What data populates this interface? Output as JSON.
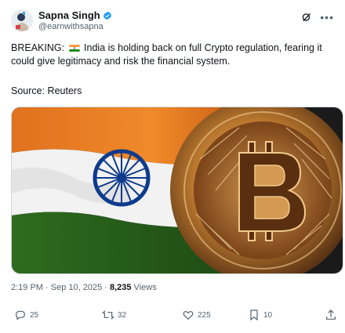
{
  "author": {
    "display_name": "Sapna Singh",
    "handle": "@earnwithsapna",
    "verified_color": "#1d9bf0"
  },
  "tweet": {
    "text_prefix": "BREAKING:",
    "text_body": "India is holding back on full Crypto regulation, fearing it could give legitimacy and risk the financial system.",
    "source": "Source: Reuters"
  },
  "meta": {
    "time": "2:19 PM · Sep 10, 2025 · ",
    "views_count": "8,235",
    "views_label": " Views"
  },
  "actions": {
    "replies": "25",
    "reposts": "32",
    "likes": "225",
    "bookmarks": "10"
  },
  "icons": [
    "verified-icon",
    "grok-icon",
    "more-icon",
    "india-flag-icon",
    "reply-icon",
    "repost-icon",
    "like-icon",
    "bookmark-icon",
    "share-icon"
  ]
}
